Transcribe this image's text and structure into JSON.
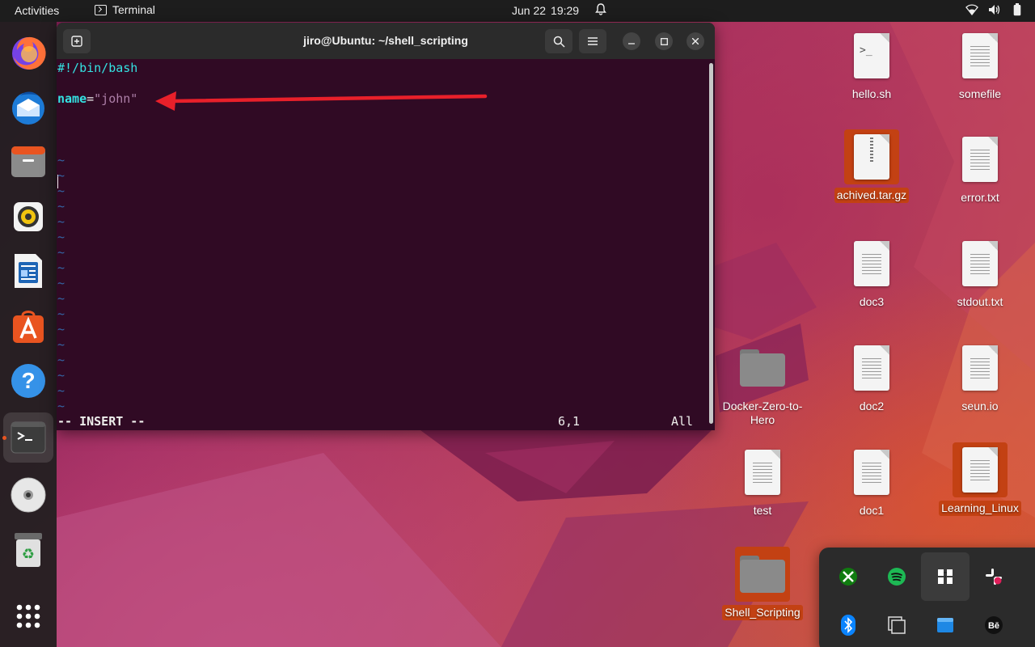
{
  "topbar": {
    "activities": "Activities",
    "app_name": "Terminal",
    "date": "Jun 22",
    "time": "19:29"
  },
  "dock": {
    "items": [
      "firefox",
      "thunderbird",
      "files",
      "rhythmbox",
      "libreoffice-writer",
      "app-center",
      "help",
      "terminal",
      "disc",
      "trash",
      "show-apps"
    ]
  },
  "terminal": {
    "title": "jiro@Ubuntu: ~/shell_scripting",
    "lines": {
      "shebang": "#!/bin/bash",
      "var_name": "name",
      "equals": "=",
      "var_value": "\"john\"",
      "tilde": "~"
    },
    "status": {
      "mode": "-- INSERT --",
      "position": "6,1",
      "scroll": "All"
    }
  },
  "desktop": {
    "icons": {
      "hello": "hello.sh",
      "somefile": "somefile",
      "archive": "achived.tar.gz",
      "error": "error.txt",
      "doc3": "doc3",
      "stdout": "stdout.txt",
      "docker": "Docker-Zero-to-Hero",
      "doc2": "doc2",
      "seun": "seun.io",
      "test": "test",
      "doc1": "doc1",
      "learning": "Learning_Linux",
      "shell": "Shell_Scripting"
    }
  },
  "tray_popup": {
    "items": [
      "xbox-icon",
      "spotify-icon",
      "notion-icon",
      "slack-icon",
      "bluetooth-icon",
      "overview-icon",
      "window-icon",
      "behance-icon"
    ]
  },
  "colors": {
    "accent": "#e95420",
    "terminal_bg": "#300a24",
    "selection": "#c34113",
    "keyword": "#34e2e2",
    "string": "#ad7fa8",
    "arrow": "#e8202a"
  }
}
